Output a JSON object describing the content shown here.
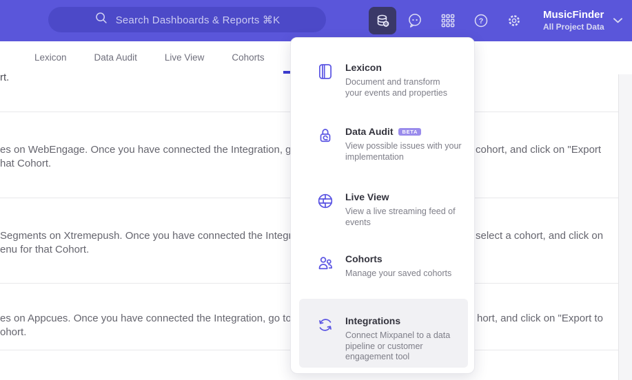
{
  "topbar": {
    "search_placeholder": "Search Dashboards & Reports ⌘K",
    "project_name": "MusicFinder",
    "project_scope": "All Project Data"
  },
  "nav": {
    "tabs": [
      "Lexicon",
      "Data Audit",
      "Live View",
      "Cohorts"
    ]
  },
  "menu": {
    "items": [
      {
        "title": "Lexicon",
        "badge": "",
        "description": "Document and transform your events and properties"
      },
      {
        "title": "Data Audit",
        "badge": "BETA",
        "description": "View possible issues with your implementation"
      },
      {
        "title": "Live View",
        "badge": "",
        "description": "View a live streaming feed of events"
      },
      {
        "title": "Cohorts",
        "badge": "",
        "description": "Manage your saved cohorts"
      },
      {
        "title": "Integrations",
        "badge": "",
        "description": "Connect Mixpanel to a data pipeline or customer engagement tool"
      }
    ]
  },
  "content": {
    "rows": [
      {
        "left1": "rt.",
        "left2": "",
        "right": ""
      },
      {
        "left1": "es on WebEngage. Once you have connected the Integration, go to the",
        "left2": "hat Cohort.",
        "right": "cohort, and click on \"Export"
      },
      {
        "left1": "Segments on Xtremepush. Once you have connected the Integration,",
        "left2": "enu for that Cohort.",
        "right": "select a cohort, and click on"
      },
      {
        "left1": "es on Appcues. Once you have connected the Integration, go to the M",
        "left2": "ohort.",
        "right": "hort, and click on \"Export to"
      }
    ]
  },
  "colors": {
    "topbar_bg": "#5a56da",
    "search_bg": "#4c49c8",
    "active_icon_bg": "#3a3868",
    "accent_icon": "#5b55e3",
    "tab_indicator": "#3c3cd2",
    "beta_badge_bg": "#9a8cec",
    "menu_highlight_bg": "#f1f1f4",
    "body_text": "#65656e",
    "divider": "#e8e8ea"
  }
}
